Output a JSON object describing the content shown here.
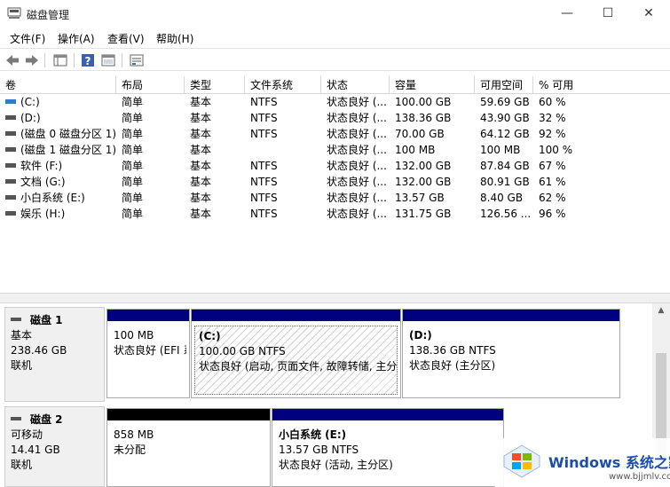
{
  "window": {
    "title": "磁盘管理",
    "minimize_glyph": "—",
    "maximize_glyph": "☐",
    "close_glyph": "✕"
  },
  "menu": [
    "文件(F)",
    "操作(A)",
    "查看(V)",
    "帮助(H)"
  ],
  "toolbar": {
    "icons": [
      "back-arrow-icon",
      "forward-arrow-icon",
      "console-tree-icon",
      "help-icon",
      "properties-icon",
      "show-list-icon"
    ]
  },
  "volume_table": {
    "columns": [
      "卷",
      "布局",
      "类型",
      "文件系统",
      "状态",
      "容量",
      "可用空间",
      "% 可用"
    ],
    "rows": [
      {
        "name": "(C:)",
        "layout": "简单",
        "type": "基本",
        "fs": "NTFS",
        "status": "状态良好 (...",
        "capacity": "100.00 GB",
        "free": "59.69 GB",
        "pct": "60 %"
      },
      {
        "name": "(D:)",
        "layout": "简单",
        "type": "基本",
        "fs": "NTFS",
        "status": "状态良好 (...",
        "capacity": "138.36 GB",
        "free": "43.90 GB",
        "pct": "32 %"
      },
      {
        "name": "(磁盘 0 磁盘分区 1)",
        "layout": "简单",
        "type": "基本",
        "fs": "NTFS",
        "status": "状态良好 (...",
        "capacity": "70.00 GB",
        "free": "64.12 GB",
        "pct": "92 %"
      },
      {
        "name": "(磁盘 1 磁盘分区 1)",
        "layout": "简单",
        "type": "基本",
        "fs": "",
        "status": "状态良好 (...",
        "capacity": "100 MB",
        "free": "100 MB",
        "pct": "100 %"
      },
      {
        "name": "软件 (F:)",
        "layout": "简单",
        "type": "基本",
        "fs": "NTFS",
        "status": "状态良好 (...",
        "capacity": "132.00 GB",
        "free": "87.84 GB",
        "pct": "67 %"
      },
      {
        "name": "文档 (G:)",
        "layout": "简单",
        "type": "基本",
        "fs": "NTFS",
        "status": "状态良好 (...",
        "capacity": "132.00 GB",
        "free": "80.91 GB",
        "pct": "61 %"
      },
      {
        "name": "小白系统 (E:)",
        "layout": "简单",
        "type": "基本",
        "fs": "NTFS",
        "status": "状态良好 (...",
        "capacity": "13.57 GB",
        "free": "8.40 GB",
        "pct": "62 %"
      },
      {
        "name": "娱乐 (H:)",
        "layout": "简单",
        "type": "基本",
        "fs": "NTFS",
        "status": "状态良好 (...",
        "capacity": "131.75 GB",
        "free": "126.56 ...",
        "pct": "96 %"
      }
    ]
  },
  "disks": [
    {
      "name": "磁盘 1",
      "type": "基本",
      "size": "238.46 GB",
      "state": "联机",
      "partitions": [
        {
          "title": "",
          "size": "100 MB",
          "status": "状态良好 (EFI 系"
        },
        {
          "title": "(C:)",
          "size": "100.00 GB NTFS",
          "status": "状态良好 (启动, 页面文件, 故障转储, 主分"
        },
        {
          "title": "(D:)",
          "size": "138.36 GB NTFS",
          "status": "状态良好 (主分区)"
        }
      ]
    },
    {
      "name": "磁盘 2",
      "type": "可移动",
      "size": "14.41 GB",
      "state": "联机",
      "partitions": [
        {
          "title": "",
          "size": "858 MB",
          "status": "未分配"
        },
        {
          "title": "小白系统 (E:)",
          "size": "13.57 GB NTFS",
          "status": "状态良好 (活动, 主分区)"
        }
      ]
    }
  ],
  "watermark": {
    "brand": "Windows 系统之家",
    "url": "www.bjjmlv.com"
  },
  "colors": {
    "primary_partition": "#000080",
    "unallocated": "#000000",
    "watermark_text": "#1a4ea8"
  }
}
